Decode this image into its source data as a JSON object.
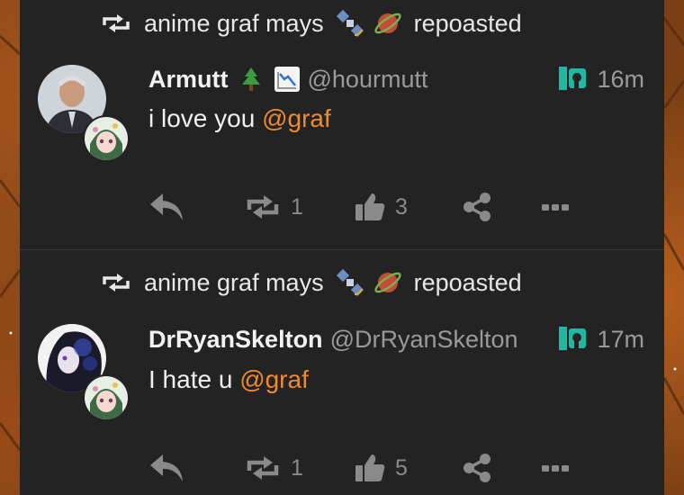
{
  "posts": [
    {
      "repost_by": "anime graf mays",
      "repost_label": "repoasted",
      "display_name": "Armutt",
      "handle": "@hourmutt",
      "time": "16m",
      "content_text": "i love you ",
      "mention": "@graf",
      "reposts": "1",
      "likes": "3",
      "name_emojis": [
        "tree-emoji",
        "chart-decreasing-emoji"
      ]
    },
    {
      "repost_by": "anime graf mays",
      "repost_label": "repoasted",
      "display_name": "DrRyanSkelton",
      "handle": "@DrRyanSkelton",
      "time": "17m",
      "content_text": "I hate u ",
      "mention": "@graf",
      "reposts": "1",
      "likes": "5",
      "name_emojis": []
    }
  ],
  "colors": {
    "background": "#232323",
    "mention": "#f08a2a",
    "visibility_icon": "#1fb8a0"
  },
  "icons": [
    "repost-icon",
    "satellite-emoji",
    "ringed-planet-emoji",
    "visibility-icon",
    "reply-icon",
    "thumbs-up-icon",
    "share-icon",
    "more-icon"
  ]
}
